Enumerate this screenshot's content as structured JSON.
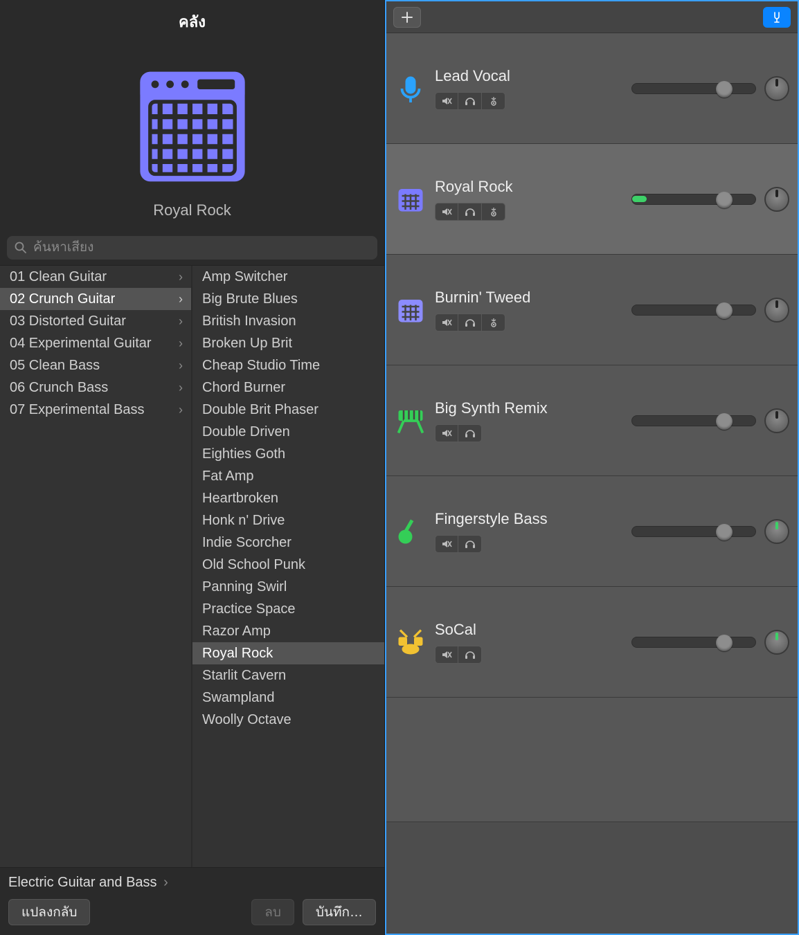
{
  "library": {
    "title": "คลัง",
    "current_preset": "Royal Rock",
    "search_placeholder": "ค้นหาเสียง",
    "categories": [
      {
        "label": "01 Clean Guitar",
        "has_children": true,
        "selected": false
      },
      {
        "label": "02 Crunch Guitar",
        "has_children": true,
        "selected": true
      },
      {
        "label": "03 Distorted Guitar",
        "has_children": true,
        "selected": false
      },
      {
        "label": "04 Experimental Guitar",
        "has_children": true,
        "selected": false
      },
      {
        "label": "05 Clean Bass",
        "has_children": true,
        "selected": false
      },
      {
        "label": "06 Crunch Bass",
        "has_children": true,
        "selected": false
      },
      {
        "label": "07 Experimental Bass",
        "has_children": true,
        "selected": false
      }
    ],
    "presets": [
      {
        "label": "Amp Switcher",
        "selected": false
      },
      {
        "label": "Big Brute Blues",
        "selected": false
      },
      {
        "label": "British Invasion",
        "selected": false
      },
      {
        "label": "Broken Up Brit",
        "selected": false
      },
      {
        "label": "Cheap Studio Time",
        "selected": false
      },
      {
        "label": "Chord Burner",
        "selected": false
      },
      {
        "label": "Double Brit Phaser",
        "selected": false
      },
      {
        "label": "Double Driven",
        "selected": false
      },
      {
        "label": "Eighties Goth",
        "selected": false
      },
      {
        "label": "Fat Amp",
        "selected": false
      },
      {
        "label": "Heartbroken",
        "selected": false
      },
      {
        "label": "Honk n' Drive",
        "selected": false
      },
      {
        "label": "Indie Scorcher",
        "selected": false
      },
      {
        "label": "Old School Punk",
        "selected": false
      },
      {
        "label": "Panning Swirl",
        "selected": false
      },
      {
        "label": "Practice Space",
        "selected": false
      },
      {
        "label": "Razor Amp",
        "selected": false
      },
      {
        "label": "Royal Rock",
        "selected": true
      },
      {
        "label": "Starlit Cavern",
        "selected": false
      },
      {
        "label": "Swampland",
        "selected": false
      },
      {
        "label": "Woolly Octave",
        "selected": false
      }
    ],
    "breadcrumb": "Electric Guitar and Bass",
    "buttons": {
      "revert": "แปลงกลับ",
      "delete": "ลบ",
      "save": "บันทึก…"
    }
  },
  "tracks": {
    "items": [
      {
        "name": "Lead Vocal",
        "icon": "mic",
        "color": "#2aa3ff",
        "selected": false,
        "has_input": true,
        "volume": 68,
        "meter": 0,
        "pan_tick": "dark"
      },
      {
        "name": "Royal Rock",
        "icon": "amp",
        "color": "#7b7bff",
        "selected": true,
        "has_input": true,
        "volume": 68,
        "meter": 12,
        "pan_tick": "dark"
      },
      {
        "name": "Burnin' Tweed",
        "icon": "amp",
        "color": "#8c8cff",
        "selected": false,
        "has_input": true,
        "volume": 68,
        "meter": 0,
        "pan_tick": "dark"
      },
      {
        "name": "Big Synth Remix",
        "icon": "synth",
        "color": "#34ce57",
        "selected": false,
        "has_input": false,
        "volume": 68,
        "meter": 0,
        "pan_tick": "dark"
      },
      {
        "name": "Fingerstyle Bass",
        "icon": "guitar",
        "color": "#34ce57",
        "selected": false,
        "has_input": false,
        "volume": 68,
        "meter": 0,
        "pan_tick": "green"
      },
      {
        "name": "SoCal",
        "icon": "drums",
        "color": "#f2c232",
        "selected": false,
        "has_input": false,
        "volume": 68,
        "meter": 0,
        "pan_tick": "green"
      }
    ]
  }
}
